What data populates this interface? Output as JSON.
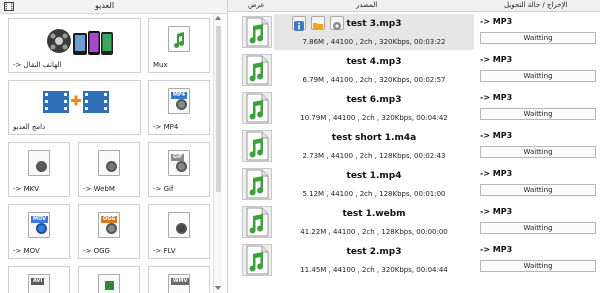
{
  "left_panel": {
    "title": "العديو",
    "tiles": [
      {
        "label": "-> الهاتف النقال",
        "icon": "mobile-devices-icon"
      },
      {
        "label": "Mux",
        "icon": "mux-icon"
      },
      {
        "label": "دامج العديو",
        "icon": "video-joiner-icon"
      },
      {
        "label": "-> MP4",
        "icon": "mp4-file-icon",
        "badge": "MP4",
        "badge_color": "#2f79c6"
      },
      {
        "label": "-> MKV",
        "icon": "mkv-file-icon"
      },
      {
        "label": "-> WebM",
        "icon": "webm-file-icon"
      },
      {
        "label": "-> Gif",
        "icon": "gif-file-icon",
        "badge": "GIF",
        "badge_color": "#8a8a8a"
      },
      {
        "label": "-> MOV",
        "icon": "mov-file-icon",
        "badge": "MOV",
        "badge_color": "#3b7dd8"
      },
      {
        "label": "-> OGG",
        "icon": "ogg-file-icon",
        "badge": "OGG",
        "badge_color": "#e0761c"
      },
      {
        "label": "-> FLV",
        "icon": "flv-file-icon"
      },
      {
        "label": "",
        "icon": "avi-file-icon",
        "badge": "AVI",
        "badge_color": "#5a5a5a"
      },
      {
        "label": "",
        "icon": "excel-file-icon"
      },
      {
        "label": "",
        "icon": "wmv-file-icon",
        "badge": "WMV",
        "badge_color": "#6b6b6b"
      }
    ]
  },
  "header": {
    "col_preview": "عرض",
    "col_source": "المصدر",
    "col_output": "الإخراج / حالة التحويل"
  },
  "files": [
    {
      "name": "test 3.mp3",
      "info": "7.86M , 44100 , 2ch , 320Kbps, 00:03:22",
      "format": "-> MP3",
      "status": "Waitting"
    },
    {
      "name": "test 4.mp3",
      "info": "6.79M , 44100 , 2ch , 320Kbps, 00:02:57",
      "format": "-> MP3",
      "status": "Waitting"
    },
    {
      "name": "test 6.mp3",
      "info": "10.79M , 44100 , 2ch , 320Kbps, 00:04:42",
      "format": "-> MP3",
      "status": "Waitting"
    },
    {
      "name": "test short 1.m4a",
      "info": "2.73M , 44100 , 2ch , 128Kbps, 00:02:43",
      "format": "-> MP3",
      "status": "Waitting"
    },
    {
      "name": "test 1.mp4",
      "info": "5.12M , 44100 , 2ch , 128Kbps, 00:01:00",
      "format": "-> MP3",
      "status": "Waitting"
    },
    {
      "name": "test 1.webm",
      "info": "41.22M , 44100 , 2ch , 128Kbps, 00:00:00",
      "format": "-> MP3",
      "status": "Waitting"
    },
    {
      "name": "test 2.mp3",
      "info": "11.45M , 44100 , 2ch , 320Kbps, 00:04:44",
      "format": "-> MP3",
      "status": "Waitting"
    }
  ],
  "selected_index": 0
}
